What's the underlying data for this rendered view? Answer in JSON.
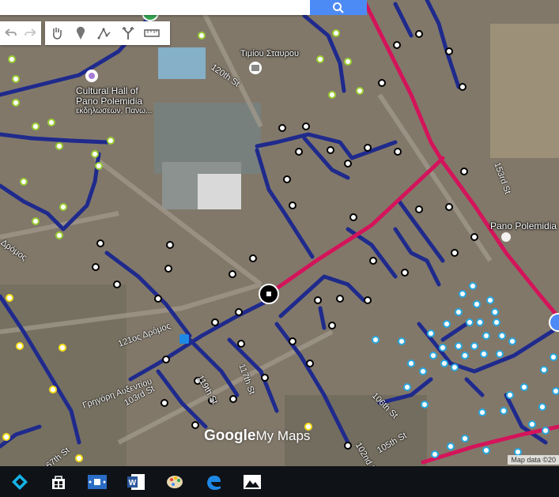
{
  "search": {
    "placeholder": ""
  },
  "toolbar": {
    "tools": [
      {
        "name": "undo-icon"
      },
      {
        "name": "redo-icon"
      },
      {
        "name": "hand-pan-icon"
      },
      {
        "name": "add-marker-icon"
      },
      {
        "name": "draw-line-icon"
      },
      {
        "name": "directions-icon"
      },
      {
        "name": "measure-ruler-icon"
      }
    ]
  },
  "places": {
    "church": "Τιμίου Σταυρου",
    "cultural_hall_line1": "Cultural Hall of",
    "cultural_hall_line2": "Pano Polemidia",
    "cultural_hall_line3": "εκδηλώσεων, Πανω...",
    "town": "Pano Polemidia"
  },
  "streets": {
    "s120th": "120th St",
    "s153rd": "153rd St",
    "s121os": "121ος Δρόμος",
    "s103rd": "103rd St",
    "s106th": "106th St",
    "s105th": "105th St",
    "s102nd": "102nd St",
    "s67th": "67th St",
    "s117th": "117th St",
    "s119th": "119th St",
    "dromos": "Δρόμος",
    "gregoris": "Γρηγόρη Αυξεντίου"
  },
  "map_data": {
    "attribution": "Map data ©20",
    "logo_prefix": "Google",
    "logo_suffix": "My Maps"
  },
  "colors": {
    "water_line": "#1f2a8c",
    "main_line": "#d4145a",
    "point_green": "#9acd32",
    "point_black": "#000000",
    "point_yellow": "#f7e01b",
    "point_cyan": "#29a8e0"
  },
  "taskbar": {
    "icons": [
      "kodi-icon",
      "store-icon",
      "media-player-icon",
      "word-icon",
      "paint-icon",
      "edge-icon",
      "photos-icon"
    ]
  }
}
